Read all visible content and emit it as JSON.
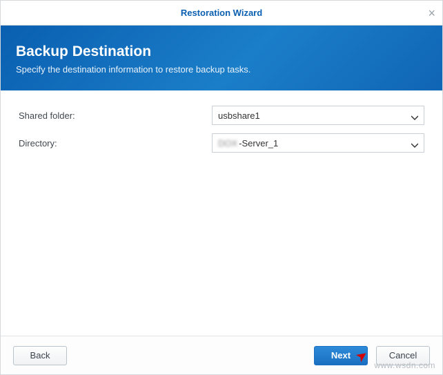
{
  "titlebar": {
    "title": "Restoration Wizard",
    "close": "×"
  },
  "banner": {
    "title": "Backup Destination",
    "description": "Specify the destination information to restore backup tasks."
  },
  "form": {
    "shared_folder": {
      "label": "Shared folder:",
      "value": "usbshare1"
    },
    "directory": {
      "label": "Directory:",
      "value_prefix": "DOX",
      "value_suffix": "-Server_1"
    }
  },
  "footer": {
    "back": "Back",
    "next": "Next",
    "cancel": "Cancel"
  },
  "watermark": "www.wsdn.com"
}
